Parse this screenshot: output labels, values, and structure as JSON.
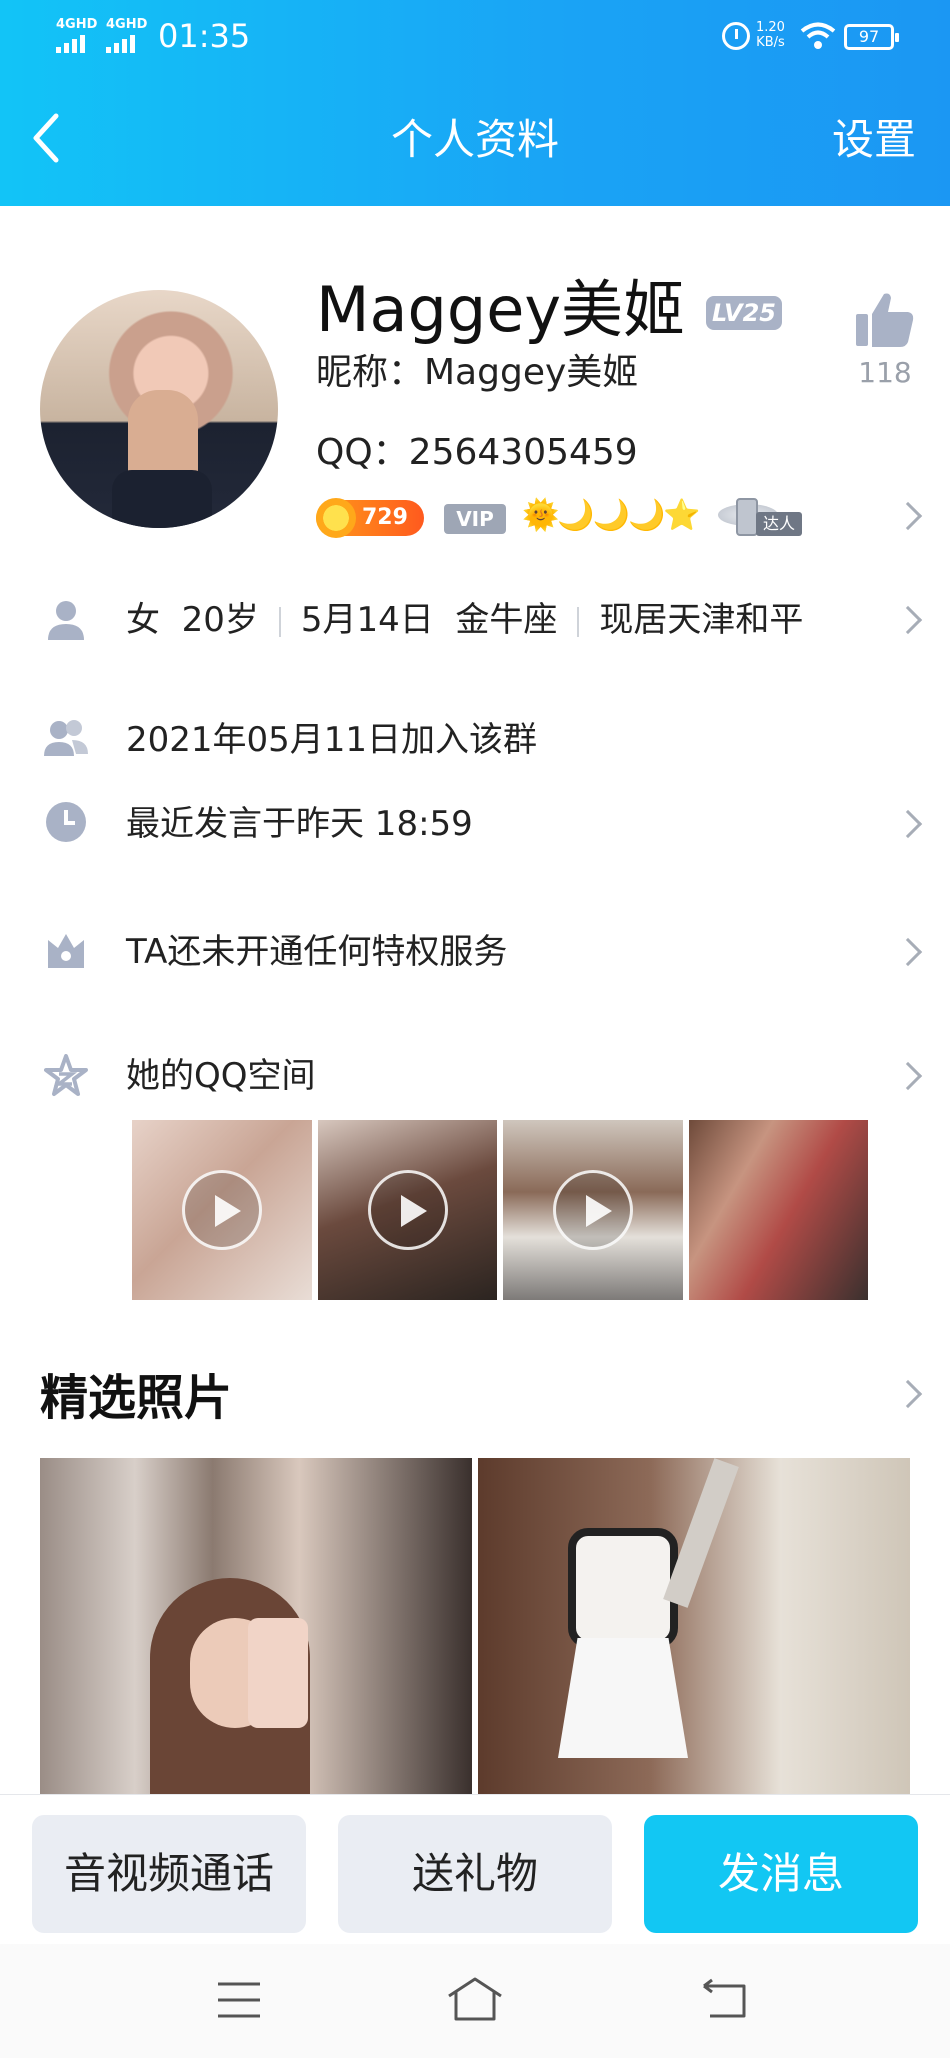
{
  "status_bar": {
    "signal1": "4GHD",
    "signal2": "4GHD",
    "time": "01:35",
    "speed_value": "1.20",
    "speed_unit": "KB/s",
    "battery": "97"
  },
  "header": {
    "title": "个人资料",
    "settings_label": "设置"
  },
  "profile": {
    "name": "Maggey美姬",
    "level_badge": "LV25",
    "nickname": "昵称：Maggey美姬",
    "qq": "QQ：2564305459",
    "likes": "118",
    "coin_value": "729",
    "vip_label": "VIP",
    "level_icons": "🌞🌙🌙🌙⭐",
    "daren_label": "达人"
  },
  "info": {
    "gender": "女",
    "age": "20岁",
    "birthday": "5月14日",
    "zodiac": "金牛座",
    "location": "现居天津和平",
    "joined": "2021年05月11日加入该群",
    "last_speak": "最近发言于昨天 18:59",
    "privilege": "TA还未开通任何特权服务",
    "qzone": "她的QQ空间"
  },
  "featured": {
    "title": "精选照片"
  },
  "actions": {
    "call": "音视频通话",
    "gift": "送礼物",
    "message": "发消息"
  },
  "colors": {
    "header_start": "#12c4f7",
    "header_end": "#1b97f3",
    "primary_button": "#12c7f3",
    "secondary_button": "#eaedf3",
    "icon_grey": "#a9b2c6"
  }
}
